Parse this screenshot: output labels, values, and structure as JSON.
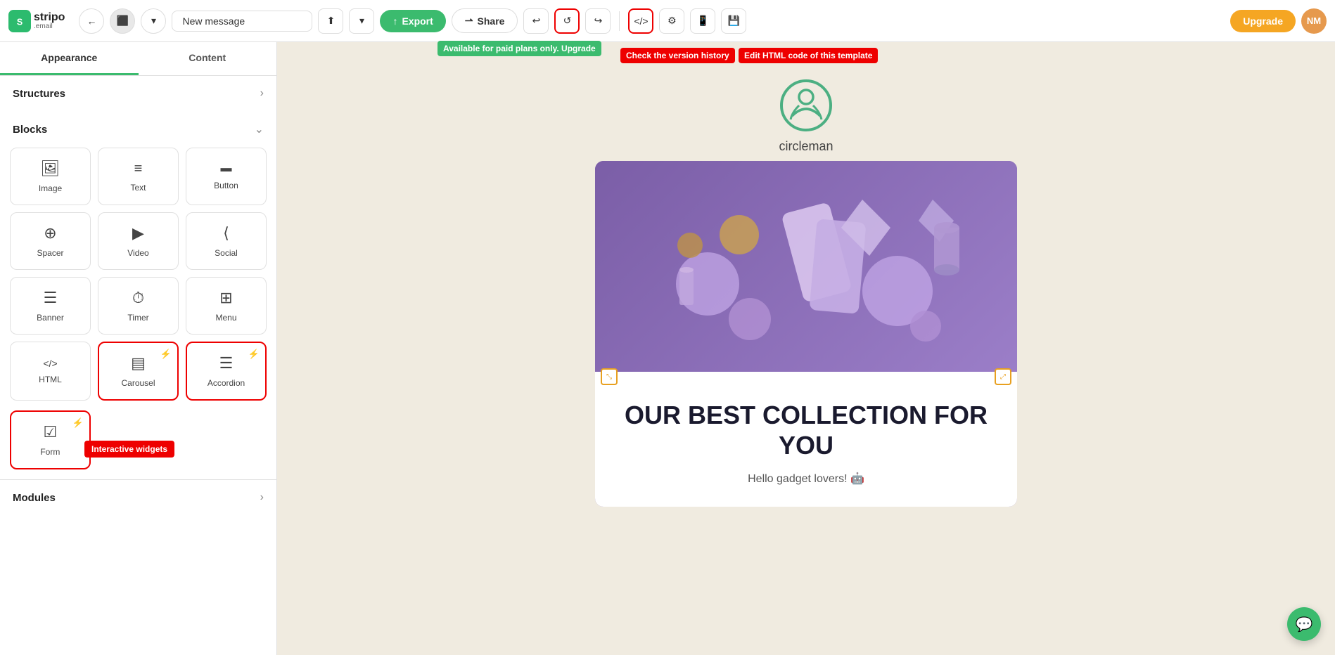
{
  "app": {
    "logo_text": "stripo",
    "logo_domain": ".email",
    "upgrade_label": "Upgrade",
    "user_initials": "NM"
  },
  "toolbar": {
    "template_name": "New message",
    "export_label": "Export",
    "share_label": "Share",
    "tooltip_version_history": "Check the version history",
    "tooltip_edit_html": "Edit HTML code of this template",
    "tooltip_paid_plans": "Available for paid plans only. Upgrade"
  },
  "left_panel": {
    "tab_appearance": "Appearance",
    "tab_content": "Content",
    "section_structures": "Structures",
    "section_blocks": "Blocks",
    "section_modules": "Modules",
    "blocks": [
      {
        "id": "image",
        "label": "Image",
        "icon": "🖼"
      },
      {
        "id": "text",
        "label": "Text",
        "icon": "≡"
      },
      {
        "id": "button",
        "label": "Button",
        "icon": "▭"
      },
      {
        "id": "spacer",
        "label": "Spacer",
        "icon": "⊕"
      },
      {
        "id": "video",
        "label": "Video",
        "icon": "▶"
      },
      {
        "id": "social",
        "label": "Social",
        "icon": "◁"
      },
      {
        "id": "banner",
        "label": "Banner",
        "icon": "☰"
      },
      {
        "id": "timer",
        "label": "Timer",
        "icon": "⏱"
      },
      {
        "id": "menu",
        "label": "Menu",
        "icon": "⊞"
      },
      {
        "id": "html",
        "label": "HTML",
        "icon": "⟨/⟩"
      },
      {
        "id": "carousel",
        "label": "Carousel",
        "icon": "▤",
        "lightning": true,
        "highlighted": true
      },
      {
        "id": "accordion",
        "label": "Accordion",
        "icon": "☰",
        "lightning": true,
        "highlighted": true
      },
      {
        "id": "form",
        "label": "Form",
        "icon": "☑",
        "lightning": true,
        "highlighted": true
      }
    ],
    "interactive_widgets_label": "Interactive widgets"
  },
  "email": {
    "brand_name": "circleman",
    "banner_title": "OUR BEST COLLECTION FOR YOU",
    "banner_subtitle": "Hello gadget lovers! 🤖"
  }
}
